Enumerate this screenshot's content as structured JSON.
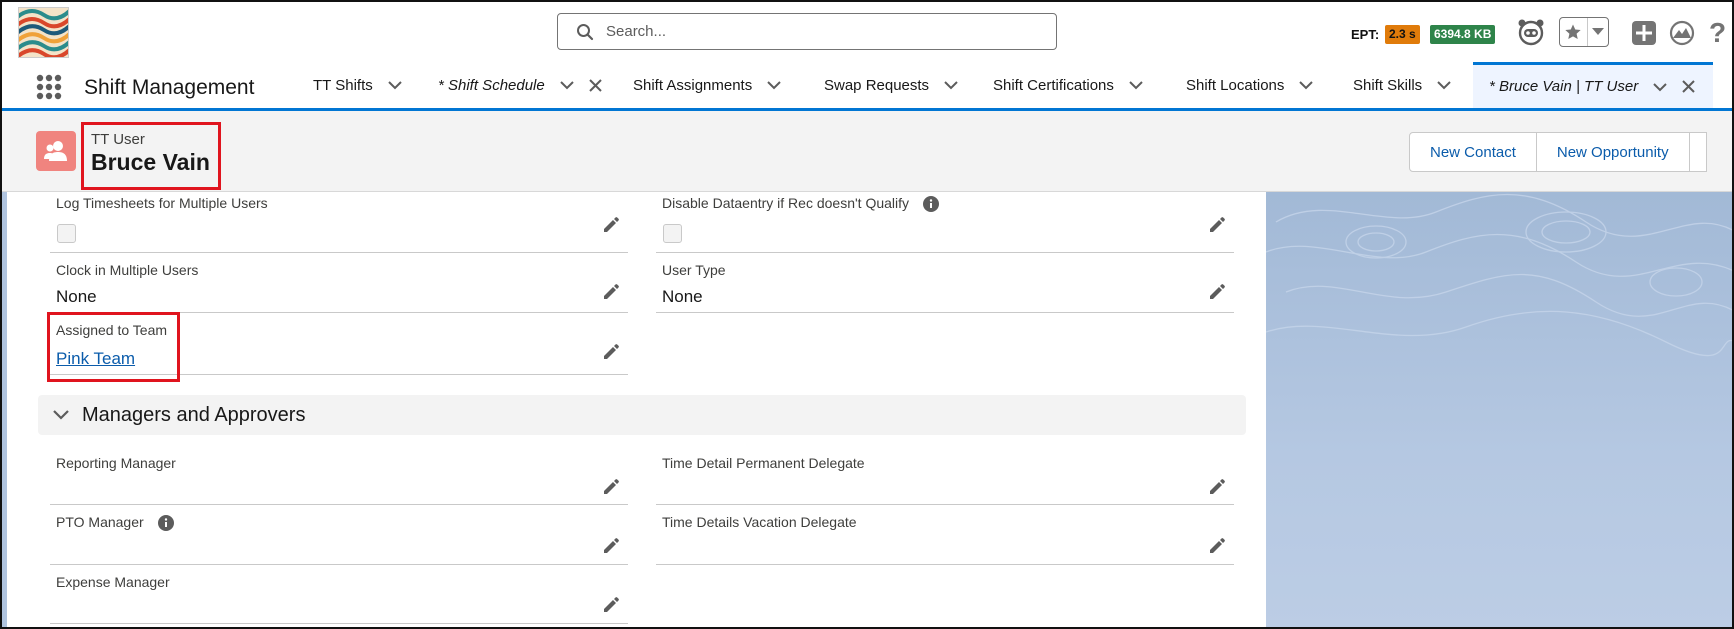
{
  "colors": {
    "brand": "#0176d3",
    "record_icon": "#f0847f",
    "highlight": "#e0141e",
    "link": "#0b5cab"
  },
  "header": {
    "search_placeholder": "Search...",
    "ept_label": "EPT:",
    "ept_time": "2.3 s",
    "ept_size": "6394.8 KB",
    "icons": [
      "astro-icon",
      "star-icon",
      "chevron-down-icon",
      "plus-icon",
      "trailhead-icon",
      "help-icon"
    ]
  },
  "nav": {
    "app_name": "Shift Management",
    "tabs": [
      {
        "label": "TT Shifts"
      },
      {
        "label": "* Shift Schedule"
      },
      {
        "label": "Shift Assignments"
      },
      {
        "label": "Swap Requests"
      },
      {
        "label": "Shift Certifications"
      },
      {
        "label": "Shift Locations"
      },
      {
        "label": "Shift Skills"
      },
      {
        "label": "* Bruce Vain | TT User"
      }
    ]
  },
  "record": {
    "type": "TT User",
    "name": "Bruce Vain",
    "actions": [
      "New Contact",
      "New Opportunity"
    ]
  },
  "fields": {
    "log_timesheets": {
      "label": "Log Timesheets for Multiple Users"
    },
    "disable_dataentry": {
      "label": "Disable Dataentry if Rec doesn't Qualify"
    },
    "clock_in": {
      "label": "Clock in Multiple Users",
      "value": "None"
    },
    "user_type": {
      "label": "User Type",
      "value": "None"
    },
    "assigned_team": {
      "label": "Assigned to Team",
      "value": "Pink Team"
    }
  },
  "section": {
    "title": "Managers and Approvers",
    "fields": {
      "reporting_manager": {
        "label": "Reporting Manager"
      },
      "time_detail_delegate": {
        "label": "Time Detail Permanent Delegate"
      },
      "pto_manager": {
        "label": "PTO Manager"
      },
      "vacation_delegate": {
        "label": "Time Details Vacation Delegate"
      },
      "expense_manager": {
        "label": "Expense Manager"
      }
    }
  }
}
